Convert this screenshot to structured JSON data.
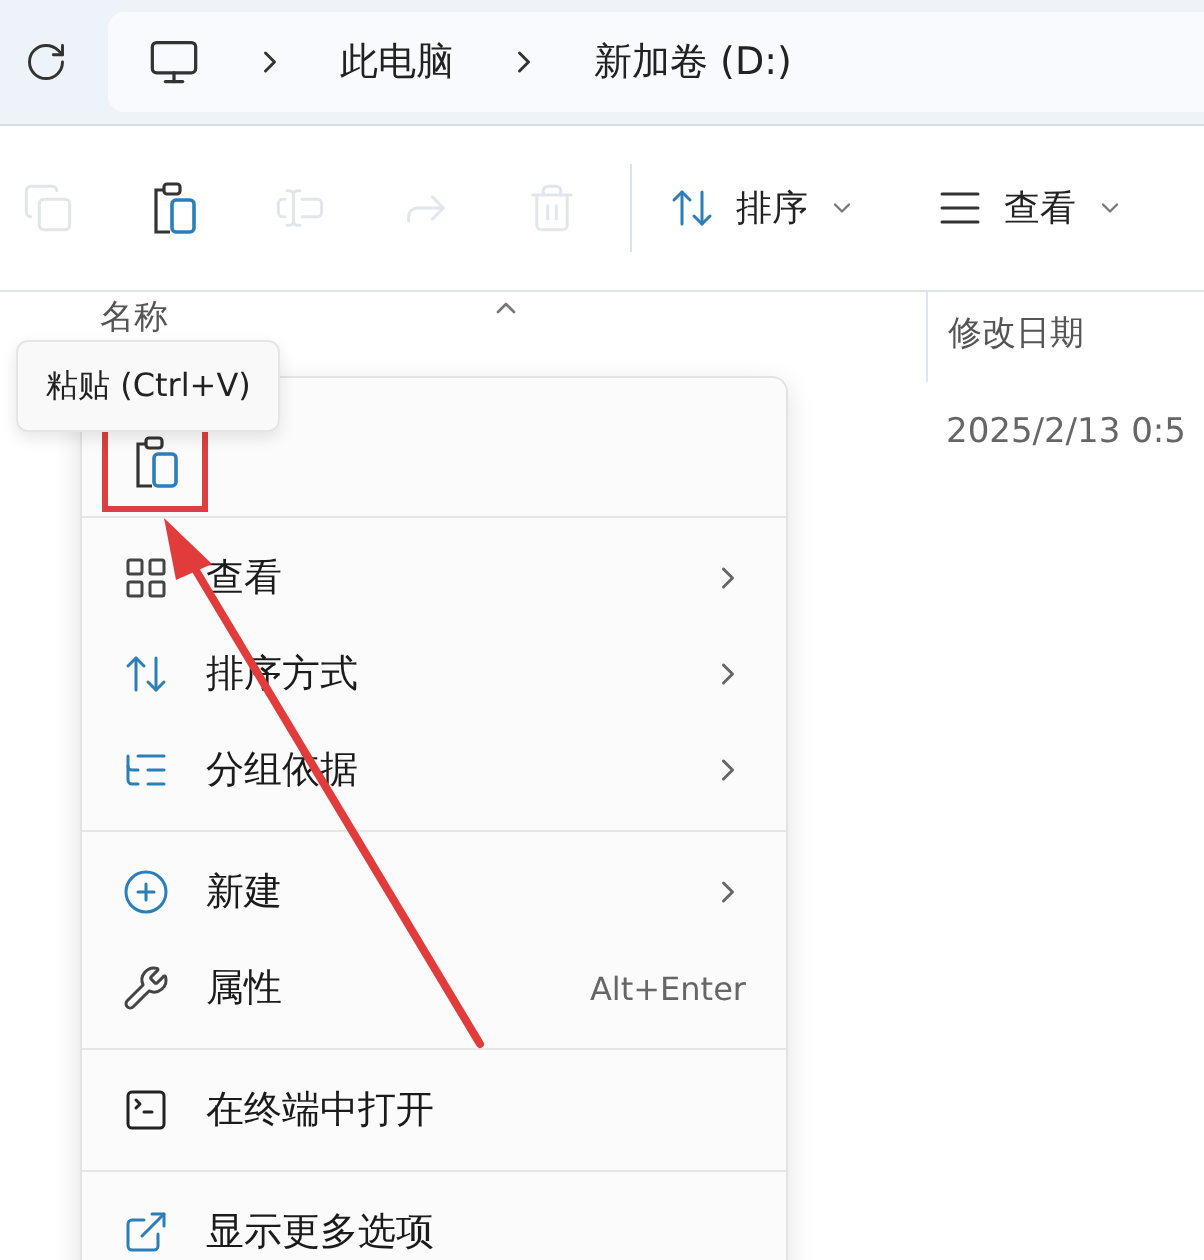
{
  "address": {
    "crumbs": [
      "此电脑",
      "新加卷 (D:)"
    ]
  },
  "toolbar": {
    "buttons": [
      {
        "kind": "copy",
        "disabled": true
      },
      {
        "kind": "paste",
        "disabled": false
      },
      {
        "kind": "rename",
        "disabled": true
      },
      {
        "kind": "share",
        "disabled": true
      },
      {
        "kind": "delete",
        "disabled": true
      }
    ],
    "sort": "排序",
    "view": "查看"
  },
  "columns": [
    "名称",
    "修改日期"
  ],
  "rows": [
    {
      "modified": "2025/2/13 0:5"
    }
  ],
  "tooltip": "粘贴 (Ctrl+V)",
  "context_menu": {
    "top_actions": [
      {
        "kind": "paste",
        "highlighted": true
      }
    ],
    "sections": [
      [
        {
          "kind": "view",
          "label": "查看",
          "submenu": true
        },
        {
          "kind": "sort",
          "label": "排序方式",
          "submenu": true
        },
        {
          "kind": "group",
          "label": "分组依据",
          "submenu": true
        }
      ],
      [
        {
          "kind": "new",
          "label": "新建",
          "submenu": true
        },
        {
          "kind": "properties",
          "label": "属性",
          "shortcut": "Alt+Enter",
          "submenu": false
        }
      ],
      [
        {
          "kind": "terminal",
          "label": "在终端中打开",
          "submenu": false
        }
      ],
      [
        {
          "kind": "more",
          "label": "显示更多选项",
          "submenu": false
        }
      ]
    ]
  },
  "annotation_arrow": true
}
